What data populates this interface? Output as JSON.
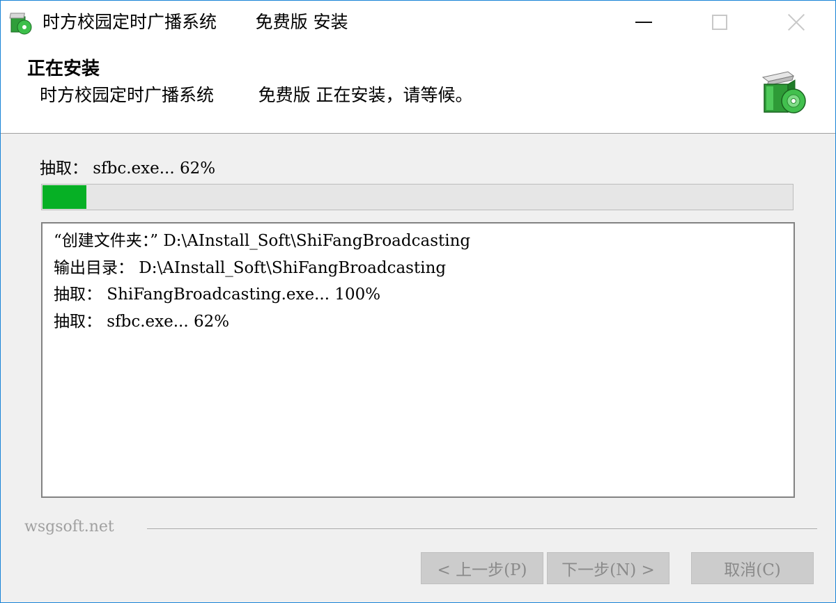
{
  "window": {
    "title_app": "时方校园定时广播系统",
    "title_action": "免费版 安装",
    "controls": {
      "minimize_icon": "minimize-icon",
      "maximize_icon": "maximize-icon",
      "close_icon": "close-icon"
    }
  },
  "header": {
    "title": "正在安装",
    "subtitle_app": "时方校园定时广播系统",
    "subtitle_status": "免费版 正在安装，请等候。",
    "icon": "installer-box-cd-icon"
  },
  "progress": {
    "label": "抽取： sfbc.exe... 62%",
    "percent": 6
  },
  "log": {
    "lines": [
      "“创建文件夹：” D:\\AInstall_Soft\\ShiFangBroadcasting",
      "输出目录： D:\\AInstall_Soft\\ShiFangBroadcasting",
      "抽取： ShiFangBroadcasting.exe... 100%",
      "抽取： sfbc.exe... 62%"
    ]
  },
  "footer": {
    "brand": "wsgsoft.net",
    "back_label": "< 上一步(P)",
    "next_label": "下一步(N) >",
    "cancel_label": "取消(C)"
  },
  "colors": {
    "progress_fill": "#06b025",
    "window_border": "#1883d7",
    "disabled_button": "#cccccc"
  }
}
